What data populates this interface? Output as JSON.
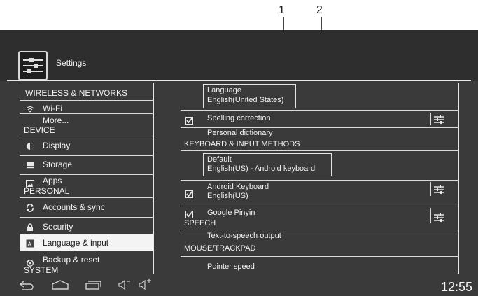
{
  "callouts": [
    "1",
    "2"
  ],
  "header": {
    "title": "Settings",
    "icon": "settings-sliders-icon"
  },
  "sidebar": {
    "sections": [
      {
        "header": "WIRELESS & NETWORKS",
        "items": [
          {
            "label": "Wi-Fi",
            "icon": "wifi-icon"
          },
          {
            "label": "More...",
            "icon": ""
          }
        ]
      },
      {
        "header": "DEVICE",
        "items": [
          {
            "label": "Display",
            "icon": "brightness-icon"
          },
          {
            "label": "Storage",
            "icon": "storage-icon"
          },
          {
            "label": "Apps",
            "icon": "apps-icon"
          }
        ]
      },
      {
        "header": "PERSONAL",
        "items": [
          {
            "label": "Accounts & sync",
            "icon": "sync-icon"
          },
          {
            "label": "Security",
            "icon": "lock-icon"
          },
          {
            "label": "Language & input",
            "icon": "language-icon",
            "selected": true
          },
          {
            "label": "Backup & reset",
            "icon": "backup-icon"
          }
        ]
      },
      {
        "header": "SYSTEM",
        "items": []
      }
    ]
  },
  "content": {
    "language": {
      "title": "Language",
      "value": "English(United States)"
    },
    "spelling": {
      "label": "Spelling correction",
      "checked": true
    },
    "personal_dictionary": {
      "label": "Personal dictionary"
    },
    "keyboard_section": "KEYBOARD & INPUT METHODS",
    "default_keyboard": {
      "title": "Default",
      "value": "English(US) - Android keyboard"
    },
    "android_keyboard": {
      "title": "Android Keyboard",
      "value": "English(US)",
      "checked": true
    },
    "google_pinyin": {
      "title": "Google Pinyin",
      "checked": true
    },
    "speech_section": "SPEECH",
    "tts": {
      "label": "Text-to-speech output"
    },
    "mouse_section": "MOUSE/TRACKPAD",
    "pointer": {
      "label": "Pointer speed"
    }
  },
  "statusbar": {
    "time": "12:55"
  },
  "colors": {
    "background": "#3a3a3a",
    "selected": "#f4f4f4",
    "text": "#f2f2f2"
  }
}
